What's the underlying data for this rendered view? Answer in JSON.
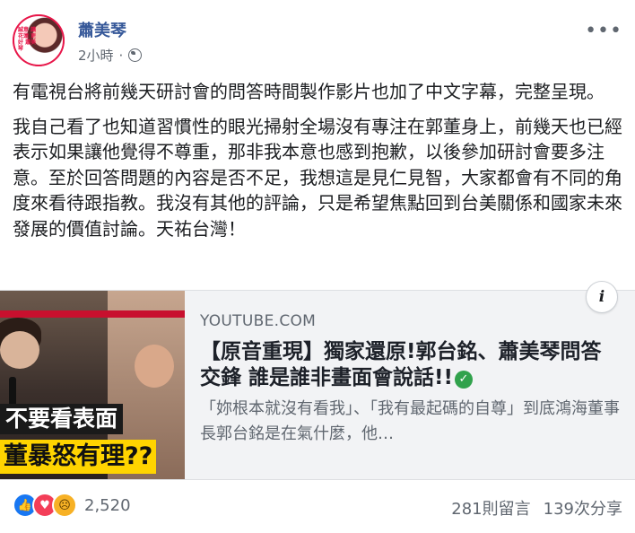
{
  "post": {
    "author": "蕭美琴",
    "time": "2小時",
    "time_separator": "·",
    "avatar_text": "誠意 讓花蓮 更好 蕭美琴",
    "paragraphs": [
      "有電視台將前幾天研討會的問答時間製作影片也加了中文字幕，完整呈現。",
      "我自己看了也知道習慣性的眼光掃射全場沒有專注在郭董身上，前幾天也已經表示如果讓他覺得不尊重，那非我本意也感到抱歉，以後參加研討會要多注意。至於回答問題的內容是否不足，我想這是見仁見智，大家都會有不同的角度來看待跟指教。我沒有其他的評論，只是希望焦點回到台美關係和國家未來發展的價值討論。天祐台灣！"
    ]
  },
  "link_card": {
    "source": "YOUTUBE.COM",
    "title": "【原音重現】獨家還原!郭台銘、蕭美琴問答交鋒 誰是誰非畫面會說話!!",
    "description": "「妳根本就沒有看我」、「我有最起碼的自尊」到底鴻海董事長郭台銘是在氣什麼，他…",
    "thumb_caption_1": "不要看表面",
    "thumb_caption_2": "董暴怒有理??",
    "info_glyph": "i",
    "check_glyph": "✓"
  },
  "footer": {
    "reaction_count": "2,520",
    "comments": "281則留言",
    "shares": "139次分享",
    "reactions": [
      "like-icon",
      "love-icon",
      "sad-icon"
    ]
  },
  "colors": {
    "author_link": "#365899",
    "meta_gray": "#606770",
    "like_blue": "#1877f2",
    "love_red": "#f33e58",
    "sad_yellow": "#f7b125",
    "thumb_yellow": "#ffd400",
    "verified_green": "#31a24c"
  }
}
